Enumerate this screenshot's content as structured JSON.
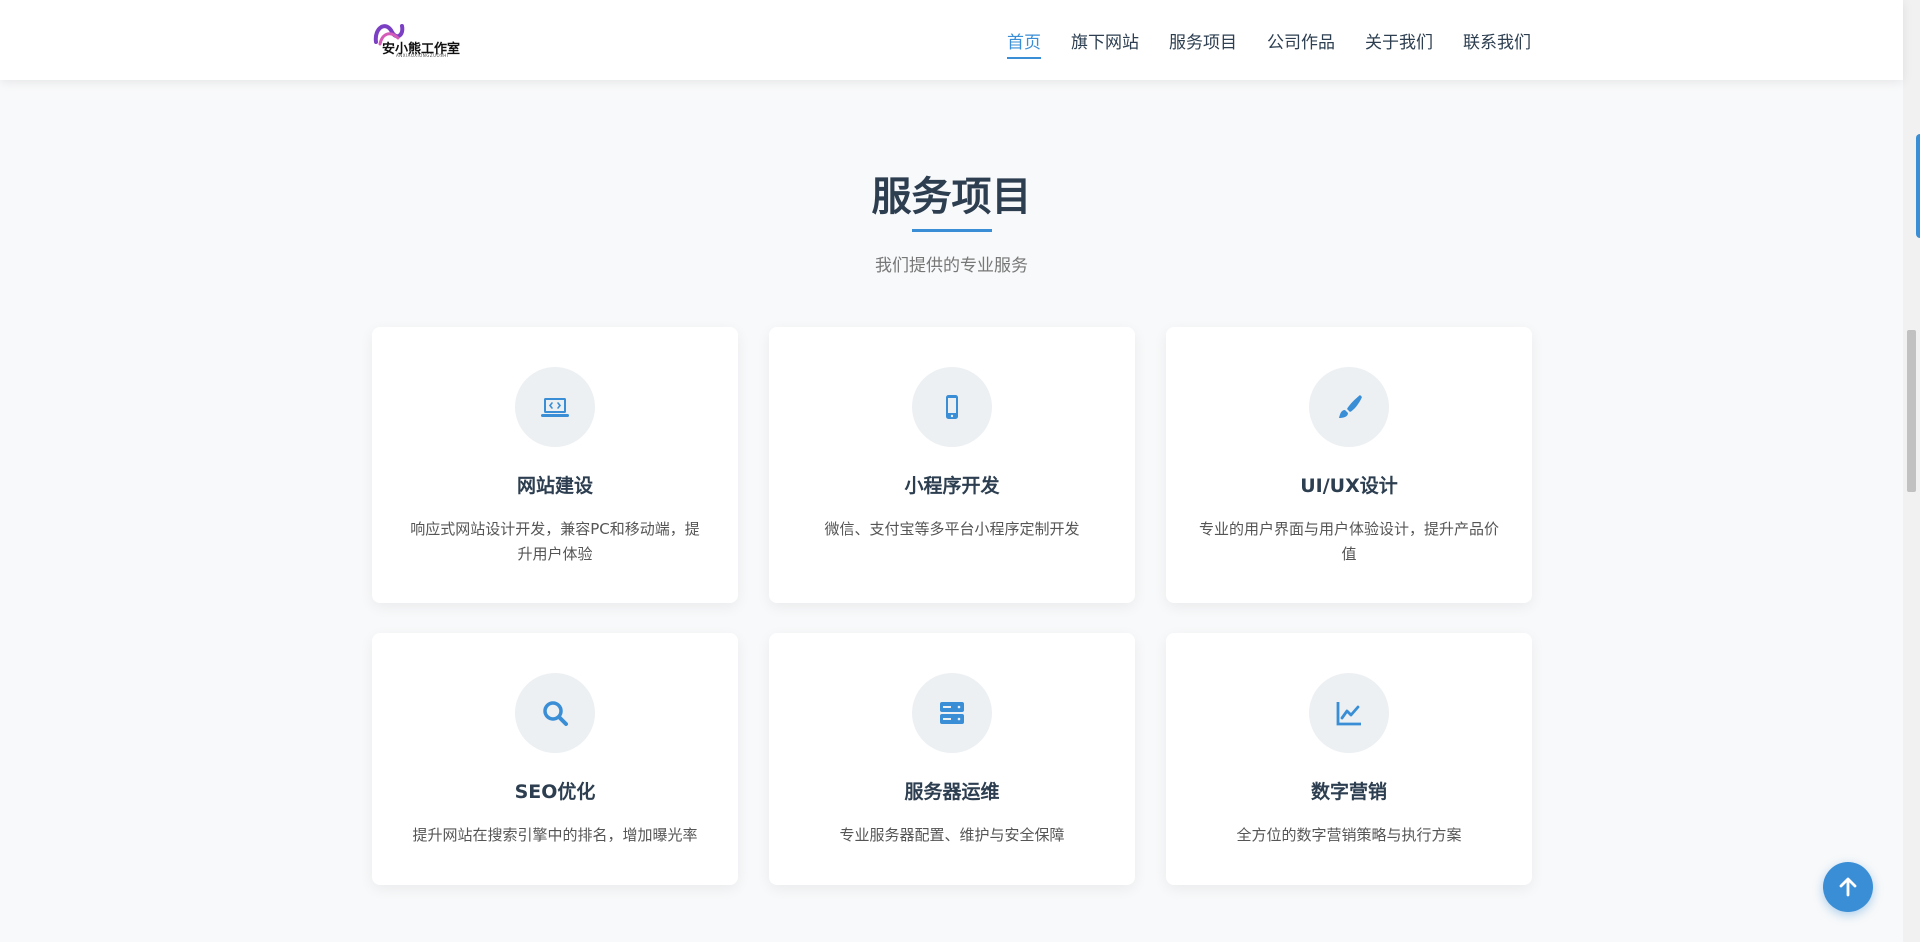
{
  "header": {
    "logo_text": "安小熊工作室",
    "logo_sub": "ANXIAOXIONGZUOSHI",
    "nav": [
      "首页",
      "旗下网站",
      "服务项目",
      "公司作品",
      "关于我们",
      "联系我们"
    ]
  },
  "section": {
    "title": "服务项目",
    "subtitle": "我们提供的专业服务"
  },
  "services": [
    {
      "icon": "laptop-code-icon",
      "title": "网站建设",
      "desc": "响应式网站设计开发，兼容PC和移动端，提升用户体验"
    },
    {
      "icon": "mobile-icon",
      "title": "小程序开发",
      "desc": "微信、支付宝等多平台小程序定制开发"
    },
    {
      "icon": "paintbrush-icon",
      "title": "UI/UX设计",
      "desc": "专业的用户界面与用户体验设计，提升产品价值"
    },
    {
      "icon": "search-icon",
      "title": "SEO优化",
      "desc": "提升网站在搜索引擎中的排名，增加曝光率"
    },
    {
      "icon": "server-icon",
      "title": "服务器运维",
      "desc": "专业服务器配置、维护与安全保障"
    },
    {
      "icon": "chart-line-icon",
      "title": "数字营销",
      "desc": "全方位的数字营销策略与执行方案"
    }
  ],
  "colors": {
    "accent": "#3a8ed6",
    "title": "#2c3e50",
    "icon_bg": "#ecf0f3"
  }
}
